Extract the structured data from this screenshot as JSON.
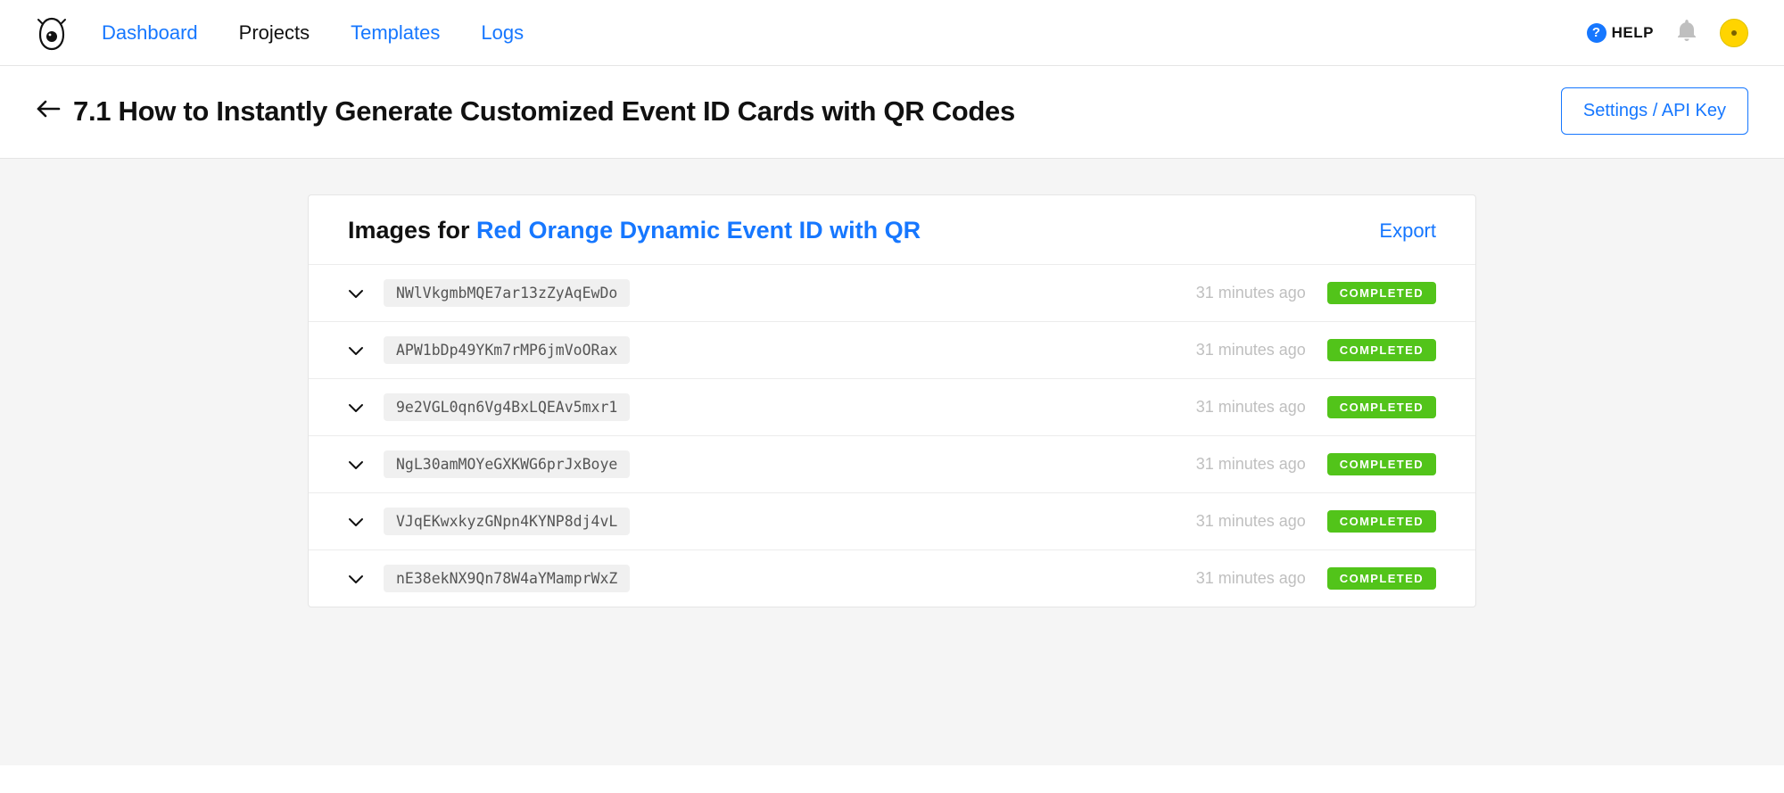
{
  "nav": {
    "items": [
      {
        "label": "Dashboard",
        "active": false
      },
      {
        "label": "Projects",
        "active": true
      },
      {
        "label": "Templates",
        "active": false
      },
      {
        "label": "Logs",
        "active": false
      }
    ],
    "help_label": "HELP"
  },
  "page": {
    "title": "7.1 How to Instantly Generate Customized Event ID Cards with QR Codes",
    "settings_button": "Settings / API Key"
  },
  "panel": {
    "title_prefix": "Images for ",
    "title_link": "Red Orange Dynamic Event ID with QR",
    "export_label": "Export",
    "rows": [
      {
        "id": "NWlVkgmbMQE7ar13zZyAqEwDo",
        "time": "31 minutes ago",
        "status": "COMPLETED"
      },
      {
        "id": "APW1bDp49YKm7rMP6jmVoORax",
        "time": "31 minutes ago",
        "status": "COMPLETED"
      },
      {
        "id": "9e2VGL0qn6Vg4BxLQEAv5mxr1",
        "time": "31 minutes ago",
        "status": "COMPLETED"
      },
      {
        "id": "NgL30amMOYeGXKWG6prJxBoye",
        "time": "31 minutes ago",
        "status": "COMPLETED"
      },
      {
        "id": "VJqEKwxkyzGNpn4KYNP8dj4vL",
        "time": "31 minutes ago",
        "status": "COMPLETED"
      },
      {
        "id": "nE38ekNX9Qn78W4aYMamprWxZ",
        "time": "31 minutes ago",
        "status": "COMPLETED"
      }
    ]
  }
}
